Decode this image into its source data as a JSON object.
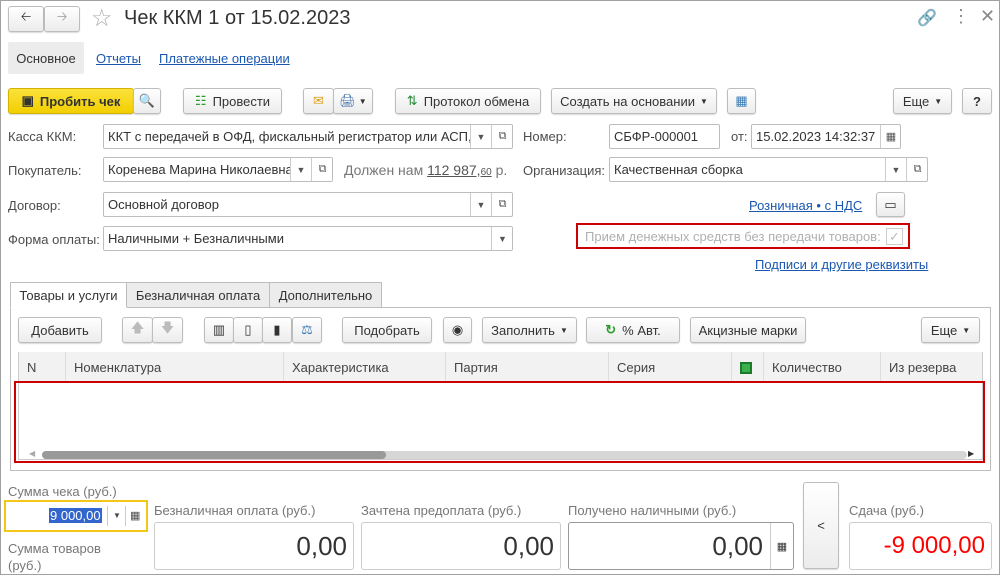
{
  "window": {
    "title": "Чек ККМ 1 от 15.02.2023"
  },
  "nav": {
    "tabs": [
      {
        "label": "Основное"
      },
      {
        "label": "Отчеты"
      },
      {
        "label": "Платежные операции"
      }
    ]
  },
  "toolbar": {
    "print_receipt": "Пробить чек",
    "post": "Провести",
    "exchange_log": "Протокол обмена",
    "create_based": "Создать на основании",
    "more": "Еще",
    "help": "?"
  },
  "form": {
    "cash_register": {
      "label": "Касса ККМ:",
      "value": "ККТ с передачей в ОФД, фискальный регистратор или АСП,"
    },
    "number": {
      "label": "Номер:",
      "value": "СБФР-000001"
    },
    "date": {
      "label": "от:",
      "value": "15.02.2023 14:32:37"
    },
    "buyer": {
      "label": "Покупатель:",
      "value": "Коренева Марина Николаевна"
    },
    "debt": {
      "prefix": "Должен нам",
      "amount": "112 987,",
      "cents": "60",
      "currency": "р."
    },
    "organization": {
      "label": "Организация:",
      "value": "Качественная сборка"
    },
    "contract": {
      "label": "Договор:",
      "value": "Основной договор"
    },
    "price_type_link": "Розничная • с НДС",
    "payment_form": {
      "label": "Форма оплаты:",
      "value": "Наличными + Безналичными"
    },
    "advance_checkbox": {
      "label": "Прием денежных средств без передачи товаров:",
      "checked": true
    },
    "signatures_link": "Подписи и другие реквизиты"
  },
  "tabs": [
    {
      "label": "Товары и услуги"
    },
    {
      "label": "Безналичная оплата"
    },
    {
      "label": "Дополнительно"
    }
  ],
  "table_toolbar": {
    "add": "Добавить",
    "pick": "Подобрать",
    "fill": "Заполнить",
    "auto_discount": "% Авт.",
    "excise": "Акцизные марки",
    "more": "Еще"
  },
  "table": {
    "columns": [
      "N",
      "Номенклатура",
      "Характеристика",
      "Партия",
      "Серия",
      "",
      "Количество",
      "Из резерва"
    ],
    "rows": []
  },
  "totals": {
    "receipt_sum": {
      "label": "Сумма чека (руб.)",
      "value": "9 000,00"
    },
    "goods_sum": {
      "label": "Сумма товаров (руб.)"
    },
    "cashless": {
      "label": "Безналичная оплата (руб.)",
      "value": "0,00"
    },
    "prepayment": {
      "label": "Зачтена предоплата (руб.)",
      "value": "0,00"
    },
    "cash_received": {
      "label": "Получено наличными (руб.)",
      "value": "0,00"
    },
    "change": {
      "label": "Сдача (руб.)",
      "value": "-9 000,00"
    },
    "transfer_button": "<"
  },
  "colors": {
    "accent_yellow": "#f5d409",
    "link": "#1a57b0",
    "highlight_red": "#cc0000",
    "negative": "#ff0000"
  }
}
